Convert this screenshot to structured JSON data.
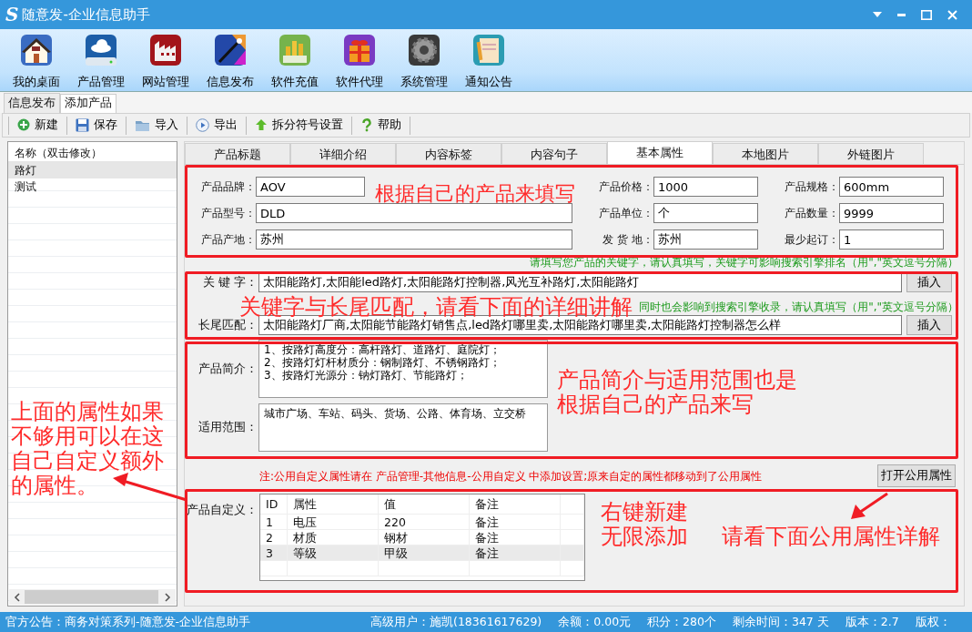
{
  "window": {
    "logo": "S",
    "title": "随意发-企业信息助手"
  },
  "ribbon": [
    {
      "label": "我的桌面"
    },
    {
      "label": "产品管理"
    },
    {
      "label": "网站管理"
    },
    {
      "label": "信息发布"
    },
    {
      "label": "软件充值"
    },
    {
      "label": "软件代理"
    },
    {
      "label": "系统管理"
    },
    {
      "label": "通知公告"
    }
  ],
  "doc_tabs": [
    {
      "label": "信息发布",
      "selected": false
    },
    {
      "label": "添加产品",
      "selected": true
    }
  ],
  "toolbar": [
    "新建",
    "保存",
    "导入",
    "导出",
    "拆分符号设置",
    "帮助"
  ],
  "product_list": {
    "header": "名称（双击修改）",
    "items": [
      {
        "label": "路灯",
        "selected": true
      },
      {
        "label": "测试",
        "selected": false
      }
    ]
  },
  "form_tabs": [
    {
      "label": "产品标题",
      "selected": false
    },
    {
      "label": "详细介绍",
      "selected": false
    },
    {
      "label": "内容标签",
      "selected": false
    },
    {
      "label": "内容句子",
      "selected": false
    },
    {
      "label": "基本属性",
      "selected": true
    },
    {
      "label": "本地图片",
      "selected": false
    },
    {
      "label": "外链图片",
      "selected": false
    }
  ],
  "attributes": [
    [
      {
        "label": "产品品牌：",
        "value": "AOV"
      },
      {
        "label": "产品型号：",
        "value": "DLD"
      },
      {
        "label": "产品产地：",
        "value": "苏州"
      }
    ],
    [
      {
        "label": "产品价格：",
        "value": "1000"
      },
      {
        "label": "产品单位：",
        "value": "个"
      },
      {
        "label": "发 货 地：",
        "value": "苏州"
      }
    ],
    [
      {
        "label": "产品规格：",
        "value": "600mm"
      },
      {
        "label": "产品数量：",
        "value": "9999"
      },
      {
        "label": "最少起订：",
        "value": "1"
      }
    ]
  ],
  "keywords": {
    "hint": "请填写您产品的关键字，请认真填写，关键字可影响搜索引擎排名（用\",\"英文逗号分隔）",
    "label": "关 键 字：",
    "value": "太阳能路灯,太阳能led路灯,太阳能路灯控制器,风光互补路灯,太阳能路灯",
    "button": "插入"
  },
  "long_tail": {
    "hint": "同时也会影响到搜索引擎收录，请认真填写（用\",\"英文逗号分隔）",
    "label": "长尾匹配：",
    "value": "太阳能路灯厂商,太阳能节能路灯销售点,led路灯哪里卖,太阳能路灯哪里卖,太阳能路灯控制器怎么样",
    "button": "插入"
  },
  "description": {
    "label": "产品简介：",
    "value": "1、按路灯高度分：高杆路灯、道路灯、庭院灯；\n2、按路灯灯杆材质分：钢制路灯、不锈钢路灯；\n3、按路灯光源分：钠灯路灯、节能路灯；"
  },
  "scope": {
    "label": "适用范围：",
    "value": "城市广场、车站、码头、货场、公路、体育场、立交桥"
  },
  "note": "注:公用自定义属性请在 产品管理-其他信息-公用自定义 中添加设置;原来自定的属性都移动到了公用属性",
  "open_button": "打开公用属性",
  "custom": {
    "label": "产品自定义：",
    "columns": [
      "ID",
      "属性",
      "值",
      "备注"
    ],
    "rows": [
      {
        "cells": [
          "1",
          "电压",
          "220",
          "备注"
        ],
        "selected": false
      },
      {
        "cells": [
          "2",
          "材质",
          "钢材",
          "备注"
        ],
        "selected": false
      },
      {
        "cells": [
          "3",
          "等级",
          "甲级",
          "备注"
        ],
        "selected": true
      }
    ]
  },
  "annotations": [
    {
      "lines": [
        "根据自己的产品来填写"
      ]
    },
    {
      "lines": [
        "关键字与长尾匹配，请看下面的详细讲解"
      ]
    },
    {
      "lines": [
        "产品简介与适用范围也是",
        "根据自己的产品来写"
      ]
    },
    {
      "lines": [
        "上面的属性如果",
        "不够用可以在这",
        "自己自定义额外",
        "的属性。"
      ]
    },
    {
      "lines": [
        "右键新建",
        "无限添加"
      ]
    },
    {
      "lines": [
        "请看下面公用属性详解"
      ]
    }
  ],
  "status_bar": {
    "notice": "官方公告：商务对策系列-随意发-企业信息助手",
    "items": [
      "高级用户：施凯(18361617629)",
      "余额：0.00元",
      "积分：280个",
      "剩余时间：347 天",
      "版本：2.7",
      "版权："
    ]
  }
}
